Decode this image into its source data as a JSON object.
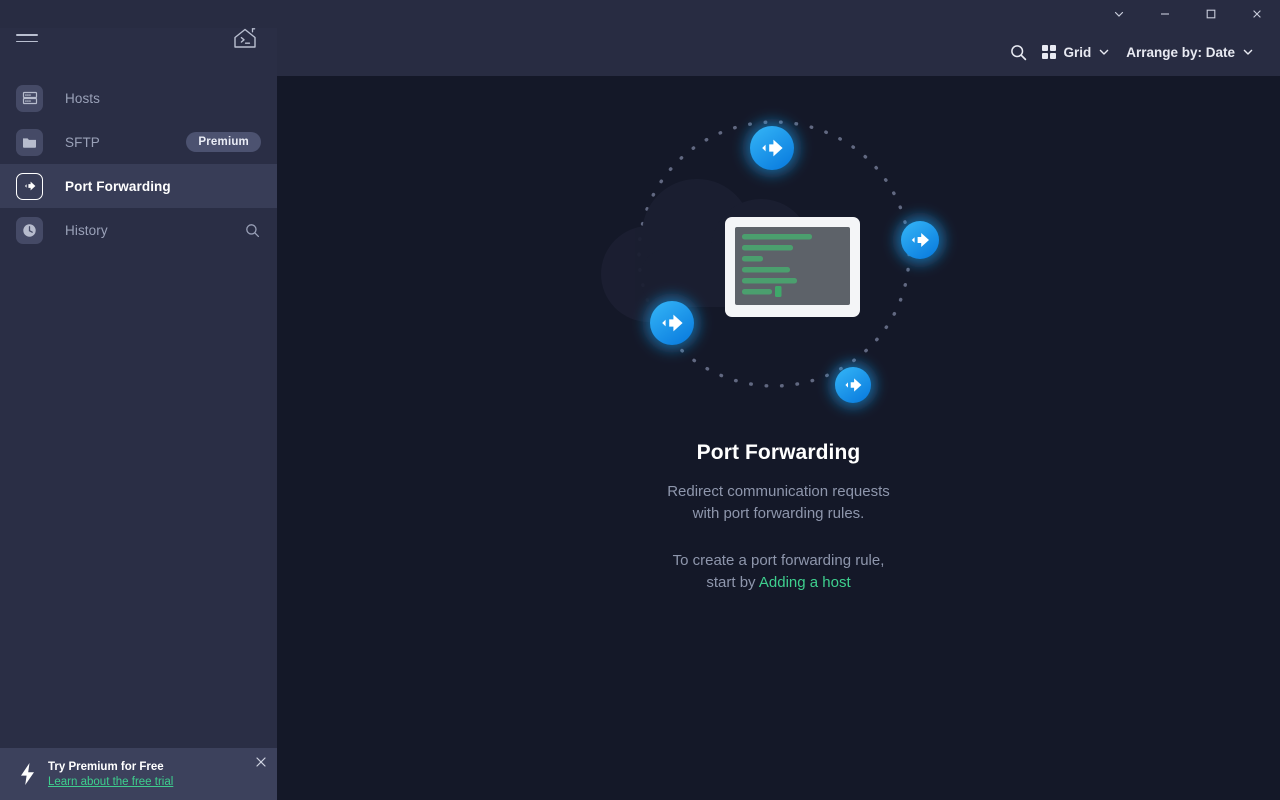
{
  "window": {
    "controls": [
      {
        "name": "chevron-down",
        "label": "⌄"
      },
      {
        "name": "minimize",
        "label": "—"
      },
      {
        "name": "maximize",
        "label": "□"
      },
      {
        "name": "close",
        "label": "✕"
      }
    ]
  },
  "sidebar": {
    "menu_icon": "hamburger-menu-icon",
    "home_icon": "home-terminal-icon",
    "items": [
      {
        "label": "Hosts",
        "icon": "server-icon",
        "selected": false,
        "badge": null,
        "action_icon": null
      },
      {
        "label": "SFTP",
        "icon": "folder-icon",
        "selected": false,
        "badge": "Premium",
        "action_icon": null
      },
      {
        "label": "Port Forwarding",
        "icon": "port-forward-arrow-icon",
        "selected": true,
        "badge": null,
        "action_icon": null
      },
      {
        "label": "History",
        "icon": "clock-icon",
        "selected": false,
        "badge": null,
        "action_icon": "search-icon"
      }
    ],
    "promo": {
      "title": "Try Premium for Free",
      "link": "Learn about the free trial",
      "icon": "lightning-bolt-icon",
      "close_icon": "close-icon"
    }
  },
  "toolbar": {
    "search_icon": "search-icon",
    "view_label": "Grid",
    "view_icon": "grid-icon",
    "arrange_label": "Arrange by: Date",
    "chevron_icon": "chevron-down-icon"
  },
  "main": {
    "illustration": "port-forwarding-cloud-terminal-illustration",
    "title": "Port Forwarding",
    "subtitle_line1": "Redirect communication requests",
    "subtitle_line2": "with port forwarding rules.",
    "cta_line1": "To create a port forwarding rule,",
    "cta_prefix": "start by ",
    "cta_link": "Adding a host"
  },
  "colors": {
    "app_background": "#141828",
    "sidebar_background": "#2a2e45",
    "selected_row": "#383d57",
    "accent_green": "#3ecf8e",
    "accent_blue": "#1ca0f0",
    "muted_text": "#8e96ac"
  }
}
